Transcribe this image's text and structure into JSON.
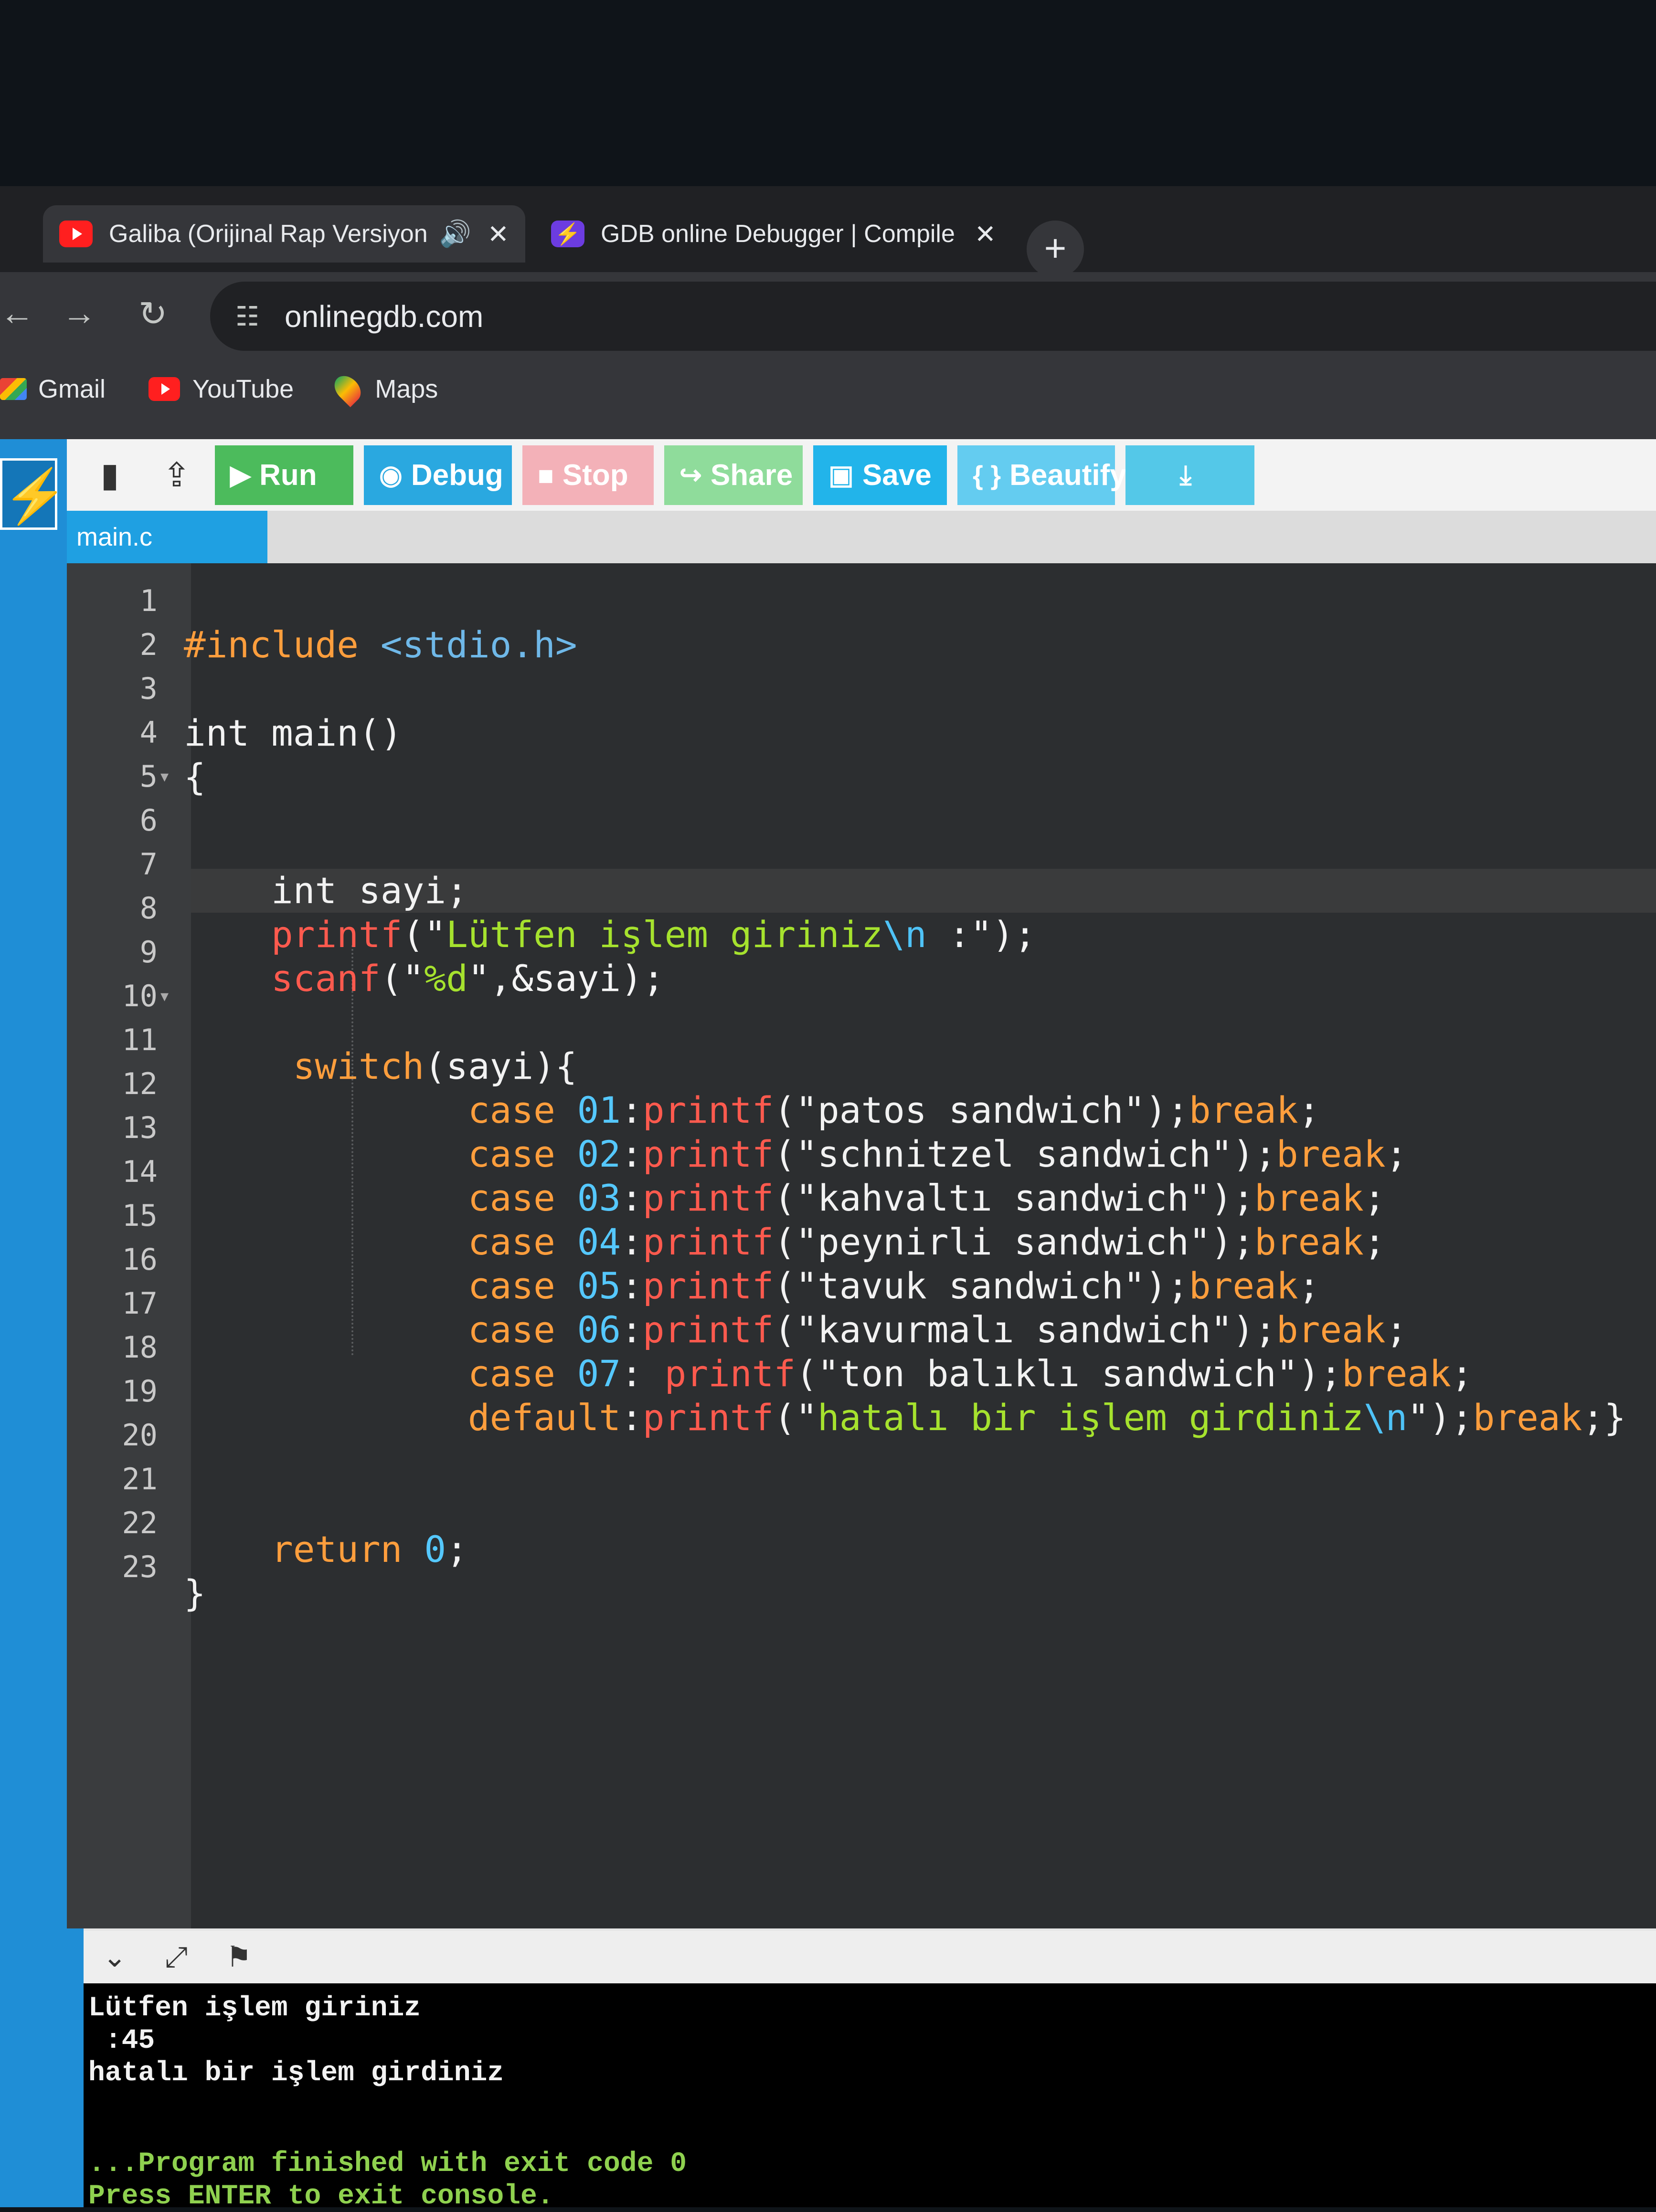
{
  "browser": {
    "tabs": [
      {
        "title": "Galiba (Orijinal Rap Versiyon",
        "icon": "youtube-icon",
        "audio": "🔊",
        "close": "✕"
      },
      {
        "title": "GDB online Debugger | Compile",
        "icon": "onlinegdb-icon",
        "close": "✕"
      }
    ],
    "new_tab": "+",
    "nav": {
      "back": "←",
      "forward": "→",
      "reload": "↻",
      "site_settings": "☷"
    },
    "url": "onlinegdb.com",
    "bookmarks": [
      {
        "label": "Gmail",
        "icon": "gmail-icon"
      },
      {
        "label": "YouTube",
        "icon": "youtube-icon"
      },
      {
        "label": "Maps",
        "icon": "maps-icon"
      }
    ]
  },
  "toolbar": {
    "new_file_icon": "▮",
    "upload_icon": "⇪",
    "run": {
      "glyph": "▶",
      "label": "Run"
    },
    "debug": {
      "glyph": "◉",
      "label": "Debug"
    },
    "stop": {
      "glyph": "■",
      "label": "Stop"
    },
    "share": {
      "glyph": "↪",
      "label": "Share"
    },
    "save": {
      "glyph": "▣",
      "label": "Save"
    },
    "beautify": {
      "glyph": "{ }",
      "label": "Beautify"
    },
    "download": {
      "glyph": "⤓"
    }
  },
  "file_tab": "main.c",
  "editor": {
    "line_numbers": [
      "1",
      "2",
      "3",
      "4",
      "5",
      "6",
      "7",
      "8",
      "9",
      "10",
      "11",
      "12",
      "13",
      "14",
      "15",
      "16",
      "17",
      "18",
      "19",
      "20",
      "21",
      "22",
      "23"
    ],
    "fold_marker": "▾",
    "active_line": 6,
    "colors": {
      "keyword": "#ff9e3d",
      "function": "#ff5a4e",
      "escape": "#4fc3f7",
      "background": "#2c2e30"
    }
  },
  "code": {
    "l2": {
      "directive": "#include",
      "header": "<stdio.h>"
    },
    "l4": {
      "type": "int",
      "rest": " main()"
    },
    "l5": "{",
    "l6": {
      "type": "int",
      "rest": " sayi;"
    },
    "l7": {
      "fn": "printf",
      "open": "(\"",
      "text": "Lütfen işlem giriniz",
      "esc": "\\n",
      "close": " :\");"
    },
    "l8": {
      "fn": "scanf",
      "open": "(\"",
      "fmt": "%d",
      "close": "\",&sayi);"
    },
    "l10": {
      "kw": "switch",
      "rest": "(sayi){"
    },
    "cases": [
      {
        "kw": "case ",
        "num": "01",
        "sep": ":",
        "fn": "printf",
        "str": "(\"patos sandwich\");",
        "brk": "break",
        "end": ";"
      },
      {
        "kw": "case ",
        "num": "02",
        "sep": ":",
        "fn": "printf",
        "str": "(\"schnitzel sandwich\");",
        "brk": "break",
        "end": ";"
      },
      {
        "kw": "case ",
        "num": "03",
        "sep": ":",
        "fn": "printf",
        "str": "(\"kahvaltı sandwich\");",
        "brk": "break",
        "end": ";"
      },
      {
        "kw": "case ",
        "num": "04",
        "sep": ":",
        "fn": "printf",
        "str": "(\"peynirli sandwich\");",
        "brk": "break",
        "end": ";"
      },
      {
        "kw": "case ",
        "num": "05",
        "sep": ":",
        "fn": "printf",
        "str": "(\"tavuk sandwich\");",
        "brk": "break",
        "end": ";"
      },
      {
        "kw": "case ",
        "num": "06",
        "sep": ":",
        "fn": "printf",
        "str": "(\"kavurmalı sandwich\");",
        "brk": "break",
        "end": ";"
      },
      {
        "kw": "case ",
        "num": "07",
        "sep": ": ",
        "fn": "printf",
        "str": "(\"ton balıklı sandwich\");",
        "brk": "break",
        "end": ";"
      }
    ],
    "l18": {
      "kw": "default",
      "sep": ":",
      "fn": "printf",
      "open": "(\"",
      "text": "hatalı bir işlem girdiniz",
      "esc": "\\n",
      "close": "\");",
      "brk": "break",
      "end": ";}"
    },
    "l21": {
      "kw": "return",
      "num": "0",
      "end": ";"
    },
    "l22": "}"
  },
  "console_bar": {
    "collapse": "⌄",
    "expand": "⤢",
    "clear": "⚑"
  },
  "console": [
    "Lütfen işlem giriniz",
    " :45",
    "hatalı bir işlem girdiniz",
    "",
    "",
    "...Program finished with exit code 0",
    "Press ENTER to exit console."
  ]
}
